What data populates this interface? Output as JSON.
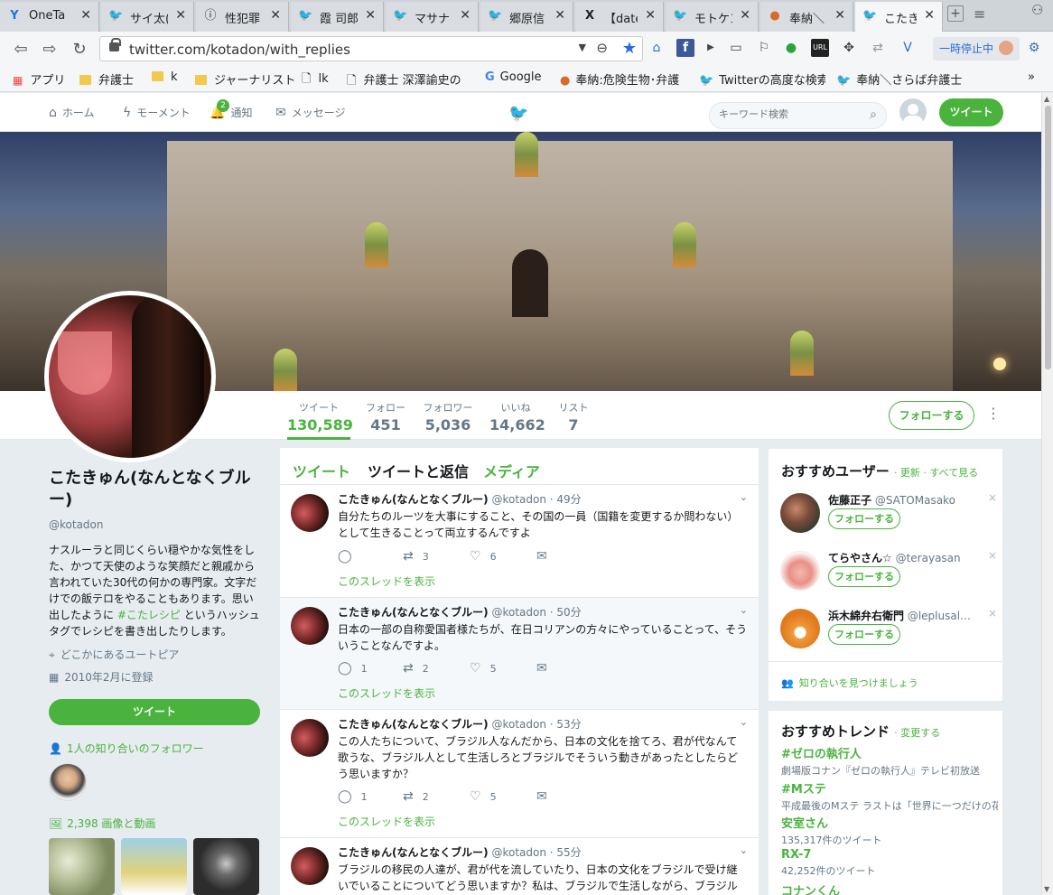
{
  "browser": {
    "tabs": [
      {
        "icon": "Y",
        "title": "OneTa"
      },
      {
        "icon": "bird",
        "title": "サイ太("
      },
      {
        "icon": "info",
        "title": "性犯罪"
      },
      {
        "icon": "bird",
        "title": "霞 司郎"
      },
      {
        "icon": "bird",
        "title": "マサナ"
      },
      {
        "icon": "bird",
        "title": "郷原信"
      },
      {
        "icon": "X",
        "title": "【date"
      },
      {
        "icon": "bird",
        "title": "モトケン"
      },
      {
        "icon": "fox",
        "title": "奉納＼"
      },
      {
        "icon": "bird",
        "title": "こたき"
      }
    ],
    "url": "twitter.com/kotadon/with_replies",
    "pause_label": "一時停止中",
    "bookmarks": [
      "アプリ",
      "弁護士",
      "k",
      "ジャーナリスト",
      "lk",
      "弁護士 深澤諭史の",
      "Google",
      "奉納:危険生物･弁護",
      "Twitterの高度な検索",
      "奉納＼さらば弁護士"
    ],
    "bookmarks_more": "»"
  },
  "nav": {
    "home": "ホーム",
    "moments": "モーメント",
    "notifications": "通知",
    "notifications_badge": "2",
    "messages": "メッセージ",
    "search_placeholder": "キーワード検索",
    "tweet_button": "ツイート"
  },
  "stats": [
    {
      "label": "ツイート",
      "value": "130,589"
    },
    {
      "label": "フォロー",
      "value": "451"
    },
    {
      "label": "フォロワー",
      "value": "5,036"
    },
    {
      "label": "いいね",
      "value": "14,662"
    },
    {
      "label": "リスト",
      "value": "7"
    }
  ],
  "follow_button": "フォローする",
  "profile": {
    "name": "こたきゅん(なんとなくブルー)",
    "handle": "@kotadon",
    "bio_1": "ナスルーラと同じくらい穏やかな気性をした、かつて天使のような笑顔だと親戚から言われていた30代の何かの専門家。文字だけでの飯テロをやることもあります。思い出したように ",
    "bio_hashtag": "#こたレシピ",
    "bio_2": " というハッシュタグでレシピを書き出したりします。",
    "location": "どこかにあるユートピア",
    "joined": "2010年2月に登録",
    "tweet_button": "ツイート",
    "known_followers": "1人の知り合いのフォロワー",
    "media_count": "2,398 画像と動画"
  },
  "timeline": {
    "tabs": [
      "ツイート",
      "ツイートと返信",
      "メディア"
    ],
    "thread_link": "このスレッドを表示",
    "tweets": [
      {
        "name": "こたきゅん(なんとなくブルー)",
        "handle": "@kotadon",
        "time": "· 49分",
        "text": "自分たちのルーツを大事にすること、その国の一員（国籍を変更するか問わない）として生きることって両立するんですよ",
        "replies": "",
        "retweets": "3",
        "likes": "6"
      },
      {
        "name": "こたきゅん(なんとなくブルー)",
        "handle": "@kotadon",
        "time": "· 50分",
        "text": "日本の一部の自称愛国者様たちが、在日コリアンの方々にやっていることって、そういうことなんですよ。",
        "replies": "1",
        "retweets": "2",
        "likes": "5"
      },
      {
        "name": "こたきゅん(なんとなくブルー)",
        "handle": "@kotadon",
        "time": "· 53分",
        "text": "この人たちについて、ブラジル人なんだから、日本の文化を捨てろ、君が代なんて歌うな、ブラジル人として生活しろとブラジルでそういう動きがあったとしたらどう思いますか？",
        "replies": "1",
        "retweets": "2",
        "likes": "5"
      },
      {
        "name": "こたきゅん(なんとなくブルー)",
        "handle": "@kotadon",
        "time": "· 55分",
        "text": "ブラジルの移民の人達が、君が代を流していたり、日本の文化をブラジルで受け継いでいることについてどう思いますか？私は、ブラジルで生活しながら、ブラジル人として生き",
        "replies": "",
        "retweets": "",
        "likes": ""
      }
    ]
  },
  "who_to_follow": {
    "title": "おすすめユーザー",
    "refresh": "· 更新 · すべて見る",
    "follow_label": "フォローする",
    "close": "×",
    "users": [
      {
        "name": "佐藤正子",
        "handle": "@SATOMasako"
      },
      {
        "name": "てらやさん☆",
        "handle": "@terayasan"
      },
      {
        "name": "浜木綿弁右衛門",
        "handle": "@leplusal…"
      }
    ],
    "find_friends": "知り合いを見つけましょう"
  },
  "trends": {
    "title": "おすすめトレンド",
    "change": "· 変更する",
    "items": [
      {
        "name": "#ゼロの執行人",
        "desc": "劇場版コナン『ゼロの執行人』テレビ初放送"
      },
      {
        "name": "#Mステ",
        "desc": "平成最後のMステ ラストは「世界に一つだけの花」"
      },
      {
        "name": "安室さん",
        "desc": "135,317件のツイート"
      },
      {
        "name": "RX-7",
        "desc": "42,252件のツイート"
      },
      {
        "name": "コナンくん",
        "desc": ""
      }
    ]
  },
  "colors": {
    "accent": "#4ab33e",
    "twitter_blue": "#1da1f2"
  }
}
